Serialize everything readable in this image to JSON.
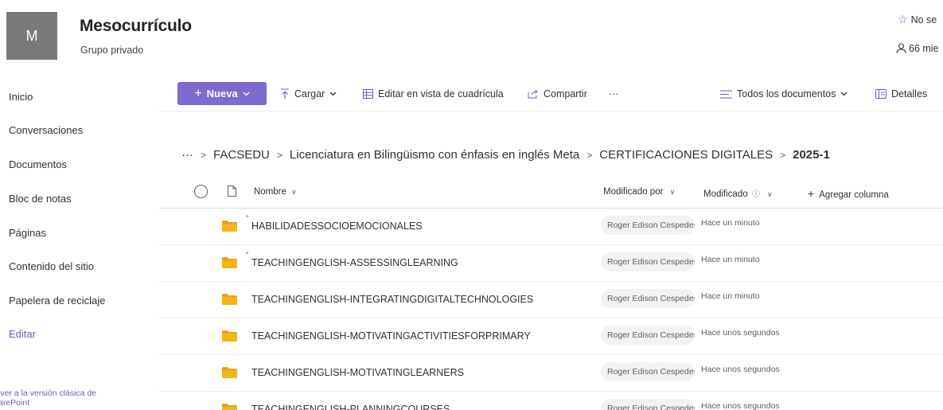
{
  "site": {
    "avatar_letter": "M",
    "title": "Mesocurrículo",
    "subtitle": "Grupo privado",
    "follow_label": "No se",
    "members_label": "66 mie"
  },
  "nav": {
    "items": [
      "Inicio",
      "Conversaciones",
      "Documentos",
      "Bloc de notas",
      "Páginas",
      "Contenido del sitio",
      "Papelera de reciclaje"
    ],
    "edit_label": "Editar",
    "footer_line1": "lver a la versión clásica de",
    "footer_line2": "arePoint"
  },
  "toolbar": {
    "new_label": "Nueva",
    "upload_label": "Cargar",
    "grid_edit_label": "Editar en vista de cuadrícula",
    "share_label": "Compartir",
    "more_label": "···",
    "view_label": "Todos los documentos",
    "details_label": "Detalles"
  },
  "breadcrumb": {
    "overflow": "···",
    "items": [
      "FACSEDU",
      "Licenciatura en Bilingüismo con énfasis en inglés Meta",
      "CERTIFICACIONES DIGITALES"
    ],
    "current": "2025-1"
  },
  "table": {
    "headers": {
      "name": "Nombre",
      "modified_by": "Modificado por",
      "modified": "Modificado",
      "add_column": "Agregar columna"
    },
    "rows": [
      {
        "name": "HABILIDADESSOCIOEMOCIONALES",
        "new": true,
        "modified_by": "Roger Edison Cespedes",
        "modified": "Hace un minuto"
      },
      {
        "name": "TEACHINGENGLISH-ASSESSINGLEARNING",
        "new": true,
        "modified_by": "Roger Edison Cespedes",
        "modified": "Hace un minuto"
      },
      {
        "name": "TEACHINGENGLISH-INTEGRATINGDIGITALTECHNOLOGIES",
        "new": false,
        "modified_by": "Roger Edison Cespedes",
        "modified": "Hace un minuto"
      },
      {
        "name": "TEACHINGENGLISH-MOTIVATINGACTIVITIESFORPRIMARY",
        "new": false,
        "modified_by": "Roger Edison Cespedes",
        "modified": "Hace unos segundos"
      },
      {
        "name": "TEACHINGENGLISH-MOTIVATINGLEARNERS",
        "new": false,
        "modified_by": "Roger Edison Cespedes",
        "modified": "Hace unos segundos"
      },
      {
        "name": "TEACHINGENGLISH-PLANNINGCOURSES",
        "new": false,
        "modified_by": "Roger Edison Cespedes",
        "modified": "Hace unos segundos"
      }
    ]
  },
  "colors": {
    "accent": "#7f6bcf",
    "folder": "#f4b41a"
  }
}
